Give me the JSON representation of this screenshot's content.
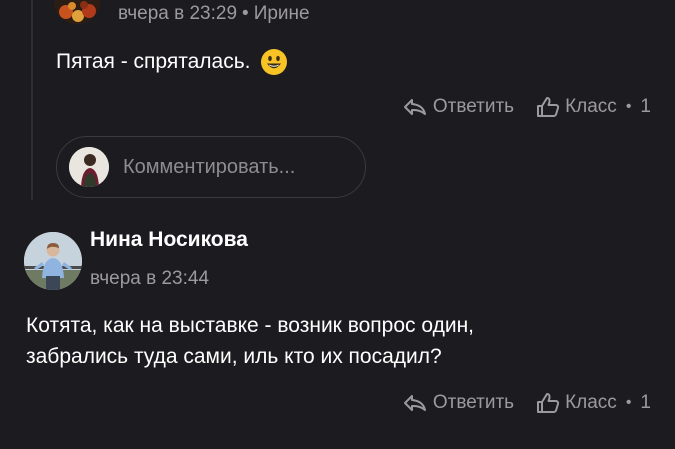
{
  "reply": {
    "timestamp": "вчера в 23:29",
    "separator": "•",
    "reply_to": "Ирине",
    "text": "Пятая - спряталась.",
    "emoji": "smiling-face-emoji",
    "actions": {
      "reply_label": "Ответить",
      "like_label": "Класс",
      "like_separator": "•",
      "like_count": "1"
    }
  },
  "comment_input": {
    "placeholder": "Комментировать..."
  },
  "comment": {
    "author": "Нина Носикова",
    "timestamp": "вчера в 23:44",
    "text_lines": [
      "Котята, как на выставке - возник вопрос один,",
      "забрались туда сами, иль кто их посадил?"
    ],
    "actions": {
      "reply_label": "Ответить",
      "like_label": "Класс",
      "like_separator": "•",
      "like_count": "1"
    }
  },
  "colors": {
    "background": "#1c1b1f",
    "text_primary": "#ffffff",
    "text_secondary": "#9c9a9f",
    "border": "#3b3a3f",
    "emoji_yellow": "#f7c325"
  }
}
